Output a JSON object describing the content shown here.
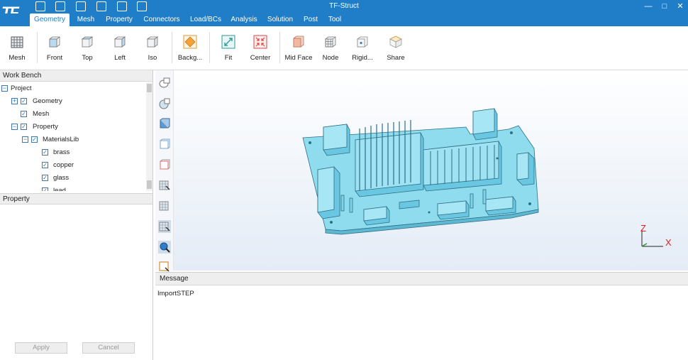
{
  "app": {
    "title": "TF-Struct",
    "logo": "TF",
    "quick_access": [
      "new-file-icon",
      "open-folder-icon",
      "save-icon",
      "import-icon",
      "export-icon",
      "script-icon"
    ]
  },
  "menu": {
    "tabs": [
      "Geometry",
      "Mesh",
      "Property",
      "Connectors",
      "Load/BCs",
      "Analysis",
      "Solution",
      "Post",
      "Tool"
    ],
    "active": "Geometry"
  },
  "ribbon": {
    "buttons": [
      {
        "label": "Mesh",
        "icon": "mesh-grid-icon"
      },
      {
        "label": "Front",
        "icon": "front-view-cube-icon"
      },
      {
        "label": "Top",
        "icon": "top-view-cube-icon"
      },
      {
        "label": "Left",
        "icon": "left-view-cube-icon"
      },
      {
        "label": "Iso",
        "icon": "iso-view-cube-icon"
      },
      {
        "label": "Backg...",
        "icon": "background-diamond-icon"
      },
      {
        "label": "Fit",
        "icon": "fit-arrows-icon"
      },
      {
        "label": "Center",
        "icon": "center-arrows-icon"
      },
      {
        "label": "Mid Face",
        "icon": "mid-face-icon"
      },
      {
        "label": "Node",
        "icon": "node-grid-icon"
      },
      {
        "label": "Rigid...",
        "icon": "rigid-icon"
      },
      {
        "label": "Share",
        "icon": "share-cube-icon"
      }
    ]
  },
  "workbench": {
    "title": "Work Bench",
    "tree": [
      {
        "label": "Project",
        "level": 0,
        "toggle": "minus",
        "checkbox": false
      },
      {
        "label": "Geometry",
        "level": 1,
        "toggle": "plus",
        "checkbox": true
      },
      {
        "label": "Mesh",
        "level": 1,
        "toggle": "",
        "checkbox": true
      },
      {
        "label": "Property",
        "level": 1,
        "toggle": "minus",
        "checkbox": true
      },
      {
        "label": "MaterialsLib",
        "level": 2,
        "toggle": "minus",
        "checkbox": true
      },
      {
        "label": "brass",
        "level": 3,
        "toggle": "",
        "checkbox": true
      },
      {
        "label": "copper",
        "level": 3,
        "toggle": "",
        "checkbox": true
      },
      {
        "label": "glass",
        "level": 3,
        "toggle": "",
        "checkbox": true
      },
      {
        "label": "lead",
        "level": 3,
        "toggle": "",
        "checkbox": true
      }
    ]
  },
  "property_panel": {
    "title": "Property",
    "apply_label": "Apply",
    "cancel_label": "Cancel"
  },
  "view_toolbar": [
    "select-solid-icon",
    "select-face-icon",
    "select-shaded-box-icon",
    "select-wire-box-icon",
    "select-edge-box-icon",
    "pick-box-icon",
    "pick-box-2-icon",
    "pick-box-3-icon",
    "zoom-pick-icon",
    "region-pick-icon"
  ],
  "viewport": {
    "model_color": "#7fd4ea",
    "axis_x": "X",
    "axis_z": "Z"
  },
  "message": {
    "title": "Message",
    "lines": [
      "ImportSTEP"
    ]
  },
  "colors": {
    "accent": "#1f7ec7"
  }
}
